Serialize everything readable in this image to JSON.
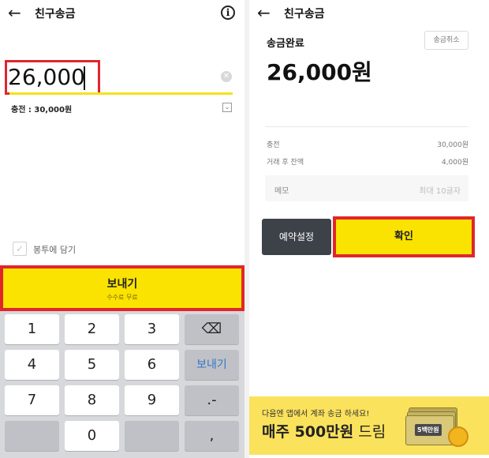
{
  "left": {
    "header": {
      "back_icon": "arrow-left-icon",
      "title": "친구송금",
      "info_icon": "info-circle-icon"
    },
    "amount_input": {
      "value": "26,000"
    },
    "charge_text": "충전 : 30,000원",
    "envelope_checkbox": {
      "label": "봉투에 담기",
      "checked": false
    },
    "send_button": {
      "label": "보내기",
      "sublabel": "수수료 무료"
    },
    "keypad": {
      "keys": [
        "1",
        "2",
        "3",
        "⌫",
        "4",
        "5",
        "6",
        "보내기",
        "7",
        "8",
        "9",
        ".-",
        "",
        "0",
        ","
      ]
    }
  },
  "right": {
    "header": {
      "back_icon": "arrow-left-icon",
      "title": "친구송금"
    },
    "status_title": "송금완료",
    "cancel_button": "송금취소",
    "amount": "26,000원",
    "details": [
      {
        "label": "충전",
        "value": "30,000원"
      },
      {
        "label": "거래 후 잔액",
        "value": "4,000원"
      }
    ],
    "memo": {
      "label": "메모",
      "placeholder": "최대 10글자"
    },
    "reserve_button": "예약설정",
    "confirm_button": "확인",
    "banner": {
      "subtext": "다음엔 앱에서 계좌 송금 하세요!",
      "main_bold": "매주 500만원",
      "main_rest": " 드림",
      "bill_label": "5백만원"
    }
  },
  "colors": {
    "accent_yellow": "#fbe300",
    "highlight_red": "#e0262c",
    "dark_button": "#3d4249",
    "keypad_blue": "#3478c8"
  }
}
